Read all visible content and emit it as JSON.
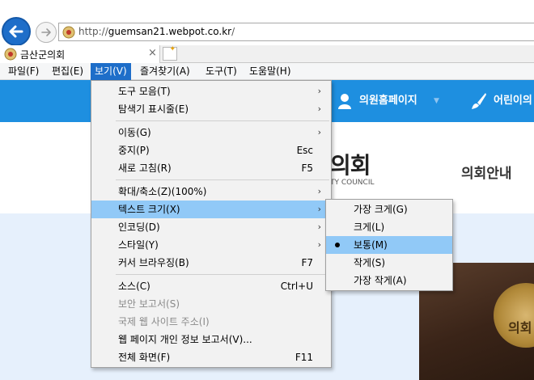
{
  "browser": {
    "url_prefix": "http://",
    "url_host": "guemsan21.webpot.co.kr",
    "url_suffix": "/",
    "tab_title": "금산군의회",
    "tab_close": "×"
  },
  "menubar": {
    "items": [
      "파일(F)",
      "편집(E)",
      "보기(V)",
      "즐겨찾기(A)",
      "도구(T)",
      "도움말(H)"
    ],
    "active": "보기(V)"
  },
  "page": {
    "nav": {
      "council_home": "의원홈페이지",
      "kids": "어린이의"
    },
    "logo_text": "의회",
    "logo_sub": "TY COUNCIL",
    "nav_right": "의회안내",
    "seal_text": "의회"
  },
  "view_menu": {
    "items": [
      {
        "label": "도구 모음(T)",
        "shortcut": "",
        "submenu": true
      },
      {
        "label": "탐색기 표시줄(E)",
        "shortcut": "",
        "submenu": true
      },
      {
        "label": "이동(G)",
        "shortcut": "",
        "submenu": true
      },
      {
        "label": "중지(P)",
        "shortcut": "Esc",
        "submenu": false
      },
      {
        "label": "새로 고침(R)",
        "shortcut": "F5",
        "submenu": false
      },
      {
        "label": "확대/축소(Z)(100%)",
        "shortcut": "",
        "submenu": true
      },
      {
        "label": "텍스트 크기(X)",
        "shortcut": "",
        "submenu": true
      },
      {
        "label": "인코딩(D)",
        "shortcut": "",
        "submenu": true
      },
      {
        "label": "스타일(Y)",
        "shortcut": "",
        "submenu": true
      },
      {
        "label": "커서 브라우징(B)",
        "shortcut": "F7",
        "submenu": false
      },
      {
        "label": "소스(C)",
        "shortcut": "Ctrl+U",
        "submenu": false
      },
      {
        "label": "보안 보고서(S)",
        "shortcut": "",
        "submenu": false,
        "disabled": true
      },
      {
        "label": "국제 웹 사이트 주소(I)",
        "shortcut": "",
        "submenu": false,
        "disabled": true
      },
      {
        "label": "웹 페이지 개인 정보 보고서(V)...",
        "shortcut": "",
        "submenu": false
      },
      {
        "label": "전체 화면(F)",
        "shortcut": "F11",
        "submenu": false
      }
    ],
    "highlighted": "텍스트 크기(X)",
    "submenu_arrow": "›"
  },
  "text_size_menu": {
    "items": [
      "가장 크게(G)",
      "크게(L)",
      "보통(M)",
      "작게(S)",
      "가장 작게(A)"
    ],
    "selected": "보통(M)"
  },
  "colors": {
    "accent": "#1e6ec9",
    "highlight": "#91c9f7",
    "nav_blue": "#1e8fe0"
  }
}
